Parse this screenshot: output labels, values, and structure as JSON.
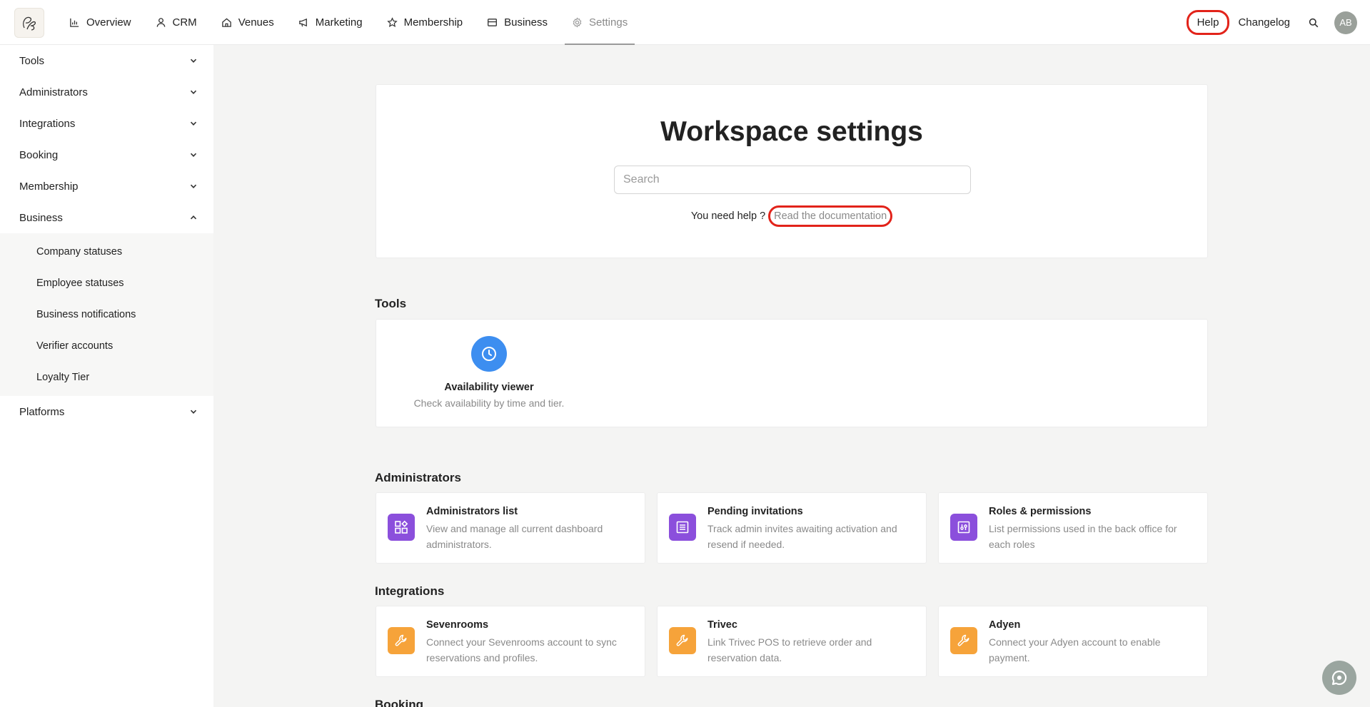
{
  "nav": {
    "items": [
      {
        "label": "Overview",
        "icon": "chart-icon"
      },
      {
        "label": "CRM",
        "icon": "user-icon"
      },
      {
        "label": "Venues",
        "icon": "home-icon"
      },
      {
        "label": "Marketing",
        "icon": "megaphone-icon"
      },
      {
        "label": "Membership",
        "icon": "star-icon"
      },
      {
        "label": "Business",
        "icon": "briefcase-icon"
      },
      {
        "label": "Settings",
        "icon": "gear-icon"
      }
    ],
    "help": "Help",
    "changelog": "Changelog",
    "avatar": "AB"
  },
  "sidebar": {
    "items": [
      {
        "label": "Tools"
      },
      {
        "label": "Administrators"
      },
      {
        "label": "Integrations"
      },
      {
        "label": "Booking"
      },
      {
        "label": "Membership"
      },
      {
        "label": "Business"
      },
      {
        "label": "Platforms"
      }
    ],
    "business_sub": [
      "Company statuses",
      "Employee statuses",
      "Business notifications",
      "Verifier accounts",
      "Loyalty Tier"
    ]
  },
  "hero": {
    "title": "Workspace settings",
    "search_placeholder": "Search",
    "help_text": "You need help ?",
    "doc_link": "Read the documentation"
  },
  "sections": {
    "tools": "Tools",
    "administrators": "Administrators",
    "integrations": "Integrations",
    "booking": "Booking"
  },
  "tools": {
    "title": "Availability viewer",
    "desc": "Check availability by time and tier."
  },
  "administrators": [
    {
      "title": "Administrators list",
      "desc": "View and manage all current dashboard administrators."
    },
    {
      "title": "Pending invitations",
      "desc": "Track admin invites awaiting activation and resend if needed."
    },
    {
      "title": "Roles & permissions",
      "desc": "List permissions used in the back office for each roles"
    }
  ],
  "integrations": [
    {
      "title": "Sevenrooms",
      "desc": "Connect your Sevenrooms account to sync reservations and profiles."
    },
    {
      "title": "Trivec",
      "desc": "Link Trivec POS to retrieve order and reservation data."
    },
    {
      "title": "Adyen",
      "desc": "Connect your Adyen account to enable payment."
    }
  ],
  "colors": {
    "accent_blue": "#3d8ef0",
    "purple": "#8b4fdc",
    "orange": "#f6a33a",
    "highlight_red": "#e2231a"
  }
}
